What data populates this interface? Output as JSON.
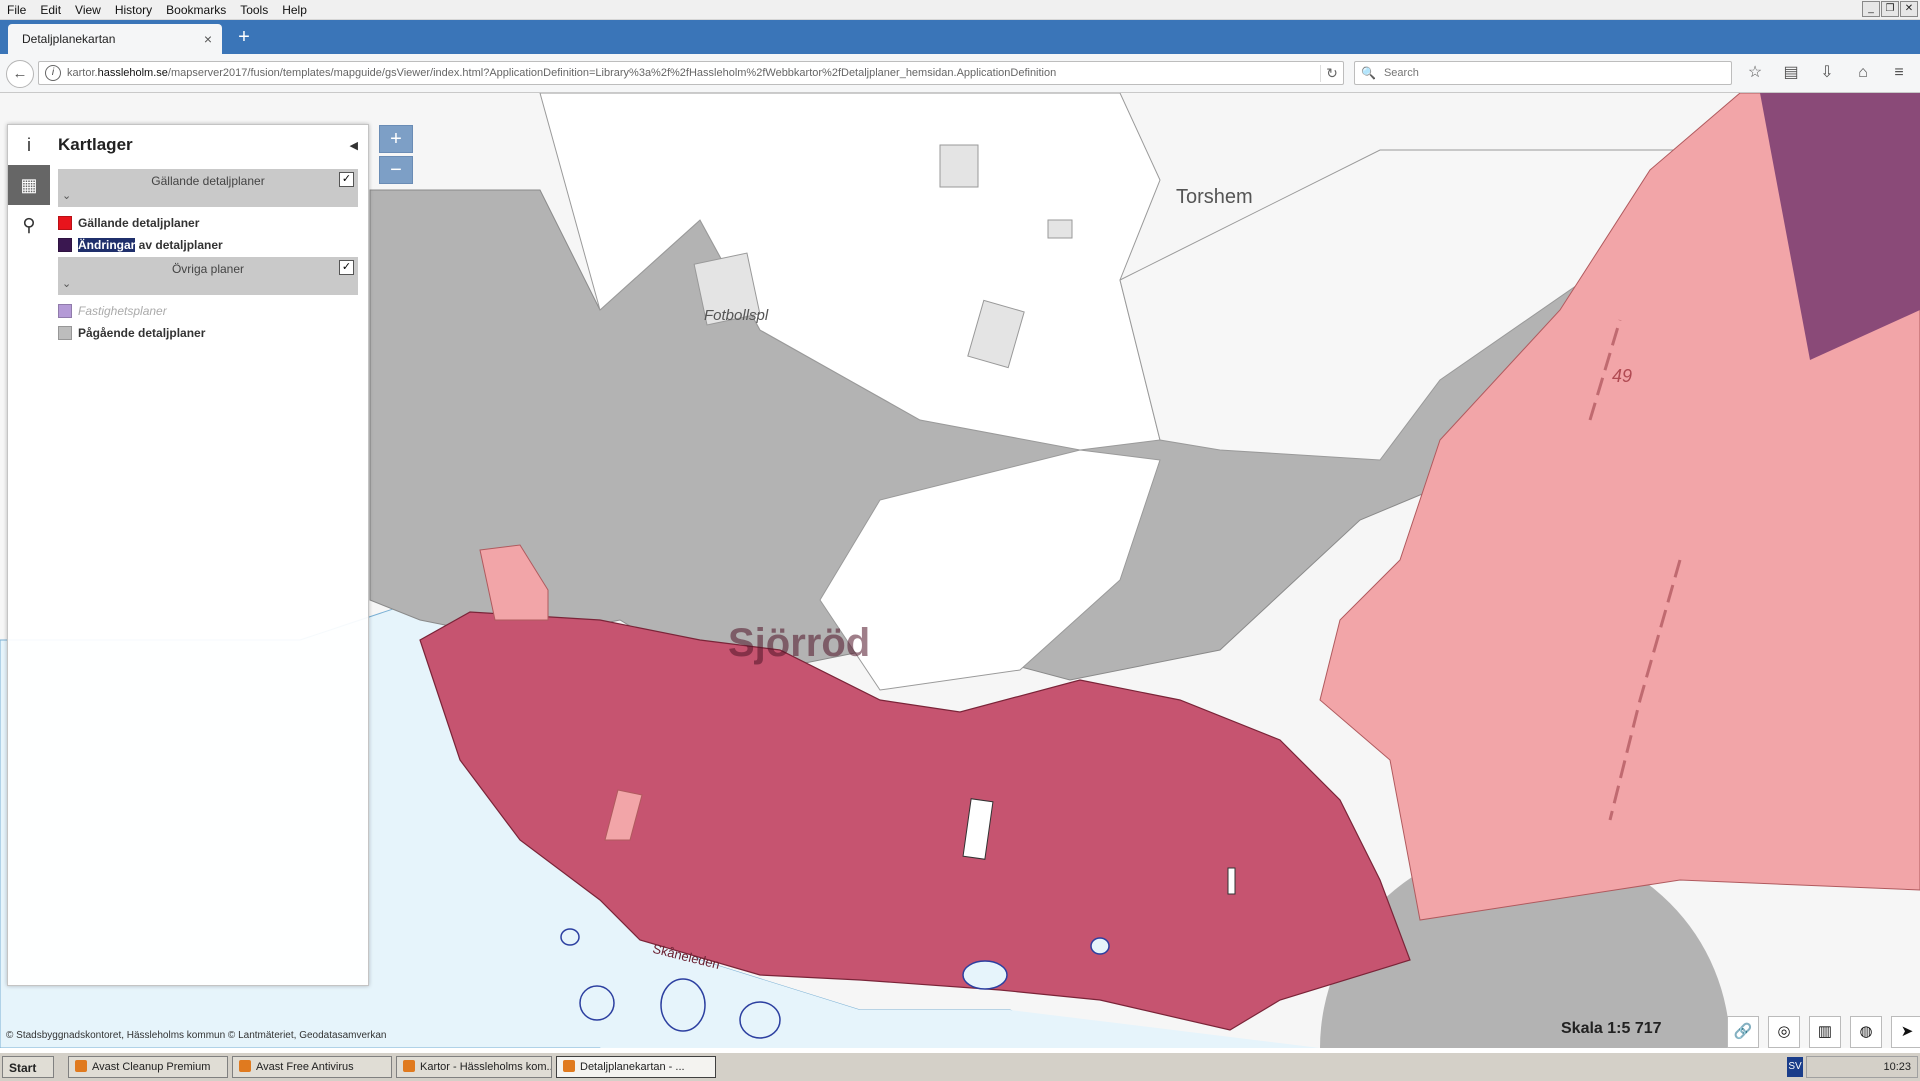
{
  "menubar": {
    "items": [
      "File",
      "Edit",
      "View",
      "History",
      "Bookmarks",
      "Tools",
      "Help"
    ]
  },
  "tab": {
    "title": "Detaljplanekartan",
    "close": "×",
    "new_tab": "+"
  },
  "address": {
    "host_prefix": "kartor.",
    "host": "hassleholm.se",
    "path": "/mapserver2017/fusion/templates/mapguide/gsViewer/index.html?ApplicationDefinition=Library%3a%2f%2fHassleholm%2fWebbkartor%2fDetaljplaner_hemsidan.ApplicationDefinition"
  },
  "search": {
    "placeholder": "Search"
  },
  "map": {
    "labels": {
      "torshem": "Torshem",
      "fotboll": "Fotbollspl",
      "sjorrod": "Sjörröd",
      "road49": "49",
      "skaneleden": "Skåneleden"
    },
    "zoom_in": "+",
    "zoom_out": "−",
    "attribution": "© Stadsbyggnadskontoret, Hässleholms kommun © Lantmäteriet, Geodatasamverkan",
    "scale": "Skala 1:5 717"
  },
  "panel": {
    "title": "Kartlager",
    "groups": [
      {
        "label": "Gällande detaljplaner",
        "checked": "✓"
      },
      {
        "label": "Övriga planer",
        "checked": "✓"
      }
    ],
    "layers": [
      {
        "label": "Gällande detaljplaner",
        "color": "#e8141c"
      },
      {
        "highlight": "Ändringar",
        "rest": " av detaljplaner",
        "color": "#3a1750"
      },
      {
        "label": "Fastighetsplaner",
        "color": "#b49ad6"
      },
      {
        "label": "Pågående detaljplaner",
        "color": "#bdbdbd"
      }
    ]
  },
  "taskbar": {
    "start": "Start",
    "tasks": [
      "Avast Cleanup Premium",
      "Avast Free Antivirus",
      "Kartor - Hässleholms kom...",
      "Detaljplanekartan - ..."
    ],
    "lang": "SV",
    "time": "10:23"
  },
  "colors": {
    "plan_dark": "#c65470",
    "plan_light": "#f2a5a8",
    "ongoing": "#b3b3b3",
    "water": "#e6f4fb",
    "purple": "#8a4a78"
  }
}
